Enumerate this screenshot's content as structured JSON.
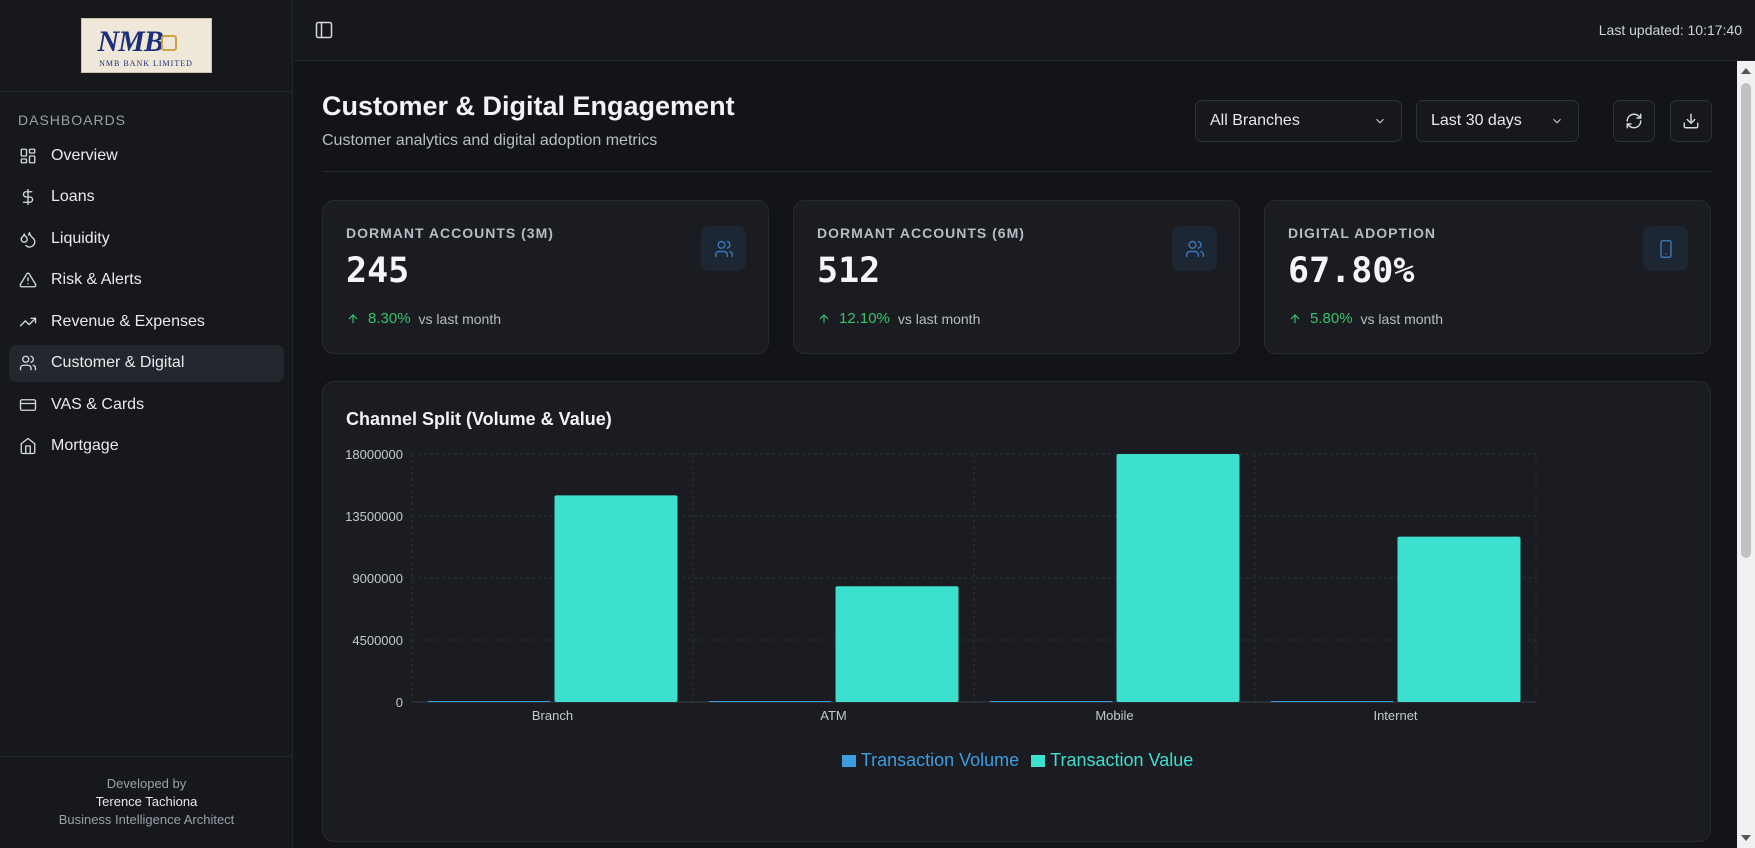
{
  "brand": {
    "logo_mark": "NMB",
    "logo_name": "NMB BANK LIMITED"
  },
  "sidebar": {
    "section": "DASHBOARDS",
    "items": [
      {
        "label": "Overview",
        "icon": "layout-grid-icon"
      },
      {
        "label": "Loans",
        "icon": "dollar-icon"
      },
      {
        "label": "Liquidity",
        "icon": "droplets-icon"
      },
      {
        "label": "Risk & Alerts",
        "icon": "warning-icon"
      },
      {
        "label": "Revenue & Expenses",
        "icon": "trending-up-icon"
      },
      {
        "label": "Customer & Digital",
        "icon": "users-icon",
        "active": true
      },
      {
        "label": "VAS & Cards",
        "icon": "credit-card-icon"
      },
      {
        "label": "Mortgage",
        "icon": "home-icon"
      }
    ],
    "footer": {
      "line1": "Developed by",
      "author": "Terence Tachiona",
      "role": "Business Intelligence Architect"
    }
  },
  "topbar": {
    "last_updated": "Last updated: 10:17:40"
  },
  "page": {
    "title": "Customer & Digital Engagement",
    "subtitle": "Customer analytics and digital adoption metrics",
    "branch_select": "All Branches",
    "period_select": "Last 30 days"
  },
  "kpis": [
    {
      "label": "DORMANT ACCOUNTS (3M)",
      "value": "245",
      "change": "8.30%",
      "compare": "vs last month",
      "icon": "users-icon"
    },
    {
      "label": "DORMANT ACCOUNTS (6M)",
      "value": "512",
      "change": "12.10%",
      "compare": "vs last month",
      "icon": "users-icon"
    },
    {
      "label": "DIGITAL ADOPTION",
      "value": "67.80%",
      "change": "5.80%",
      "compare": "vs last month",
      "icon": "smartphone-icon"
    }
  ],
  "colors": {
    "volume": "#3b9ee0",
    "value": "#3ce0cf",
    "positive": "#35c46a"
  },
  "chart_data": {
    "type": "bar",
    "title": "Channel Split (Volume & Value)",
    "categories": [
      "Branch",
      "ATM",
      "Mobile",
      "Internet"
    ],
    "series": [
      {
        "name": "Transaction Volume",
        "values": [
          0,
          0,
          0,
          0
        ]
      },
      {
        "name": "Transaction Value",
        "values": [
          15000000,
          8400000,
          18000000,
          12000000
        ]
      }
    ],
    "ylim": [
      0,
      18000000
    ],
    "yticks": [
      "0",
      "4500000",
      "9000000",
      "13500000",
      "18000000"
    ],
    "grid": true,
    "legend": "bottom"
  }
}
